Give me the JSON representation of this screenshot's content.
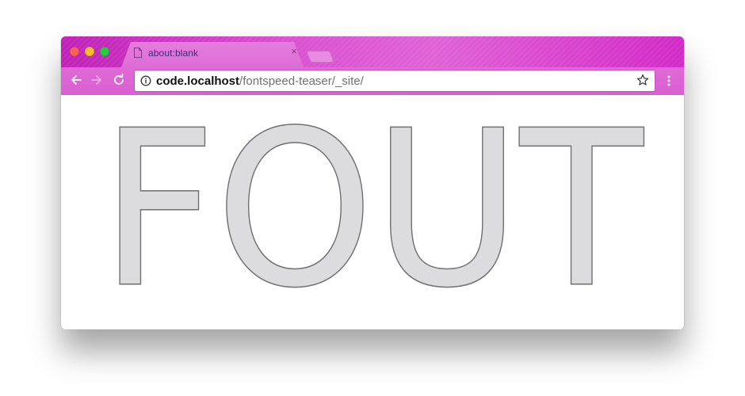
{
  "window": {
    "traffic_lights": [
      "close",
      "minimize",
      "zoom"
    ]
  },
  "tab": {
    "title": "about:blank",
    "close_glyph": "×",
    "icon": "page-icon"
  },
  "toolbar": {
    "back_icon": "back-arrow-icon",
    "forward_icon": "forward-arrow-icon",
    "reload_icon": "reload-icon",
    "menu_icon": "kebab-menu-icon"
  },
  "omnibox": {
    "info_icon": "info-icon",
    "url_host": "code.localhost",
    "url_path": "/fontspeed-teaser/_site/",
    "bookmark_icon": "star-icon"
  },
  "page": {
    "heading": "FOUT"
  },
  "colors": {
    "chrome_accent": "#d94fd0",
    "text_fill": "#dcdcde",
    "text_stroke": "#6f6f6f"
  }
}
